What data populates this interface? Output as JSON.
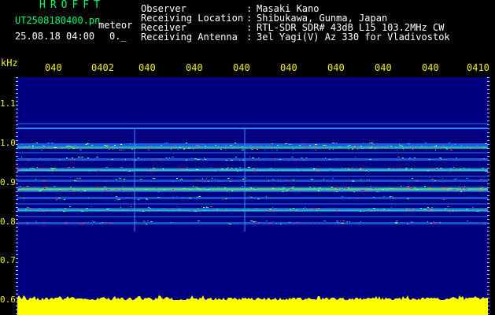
{
  "header": {
    "brand": "HROFFT",
    "filename": "UT2508180400.pn",
    "meteor_label": "meteor",
    "datetime": "25.08.18 04:00",
    "unknown_value": "0._"
  },
  "info": {
    "rows": [
      {
        "label": "Observer",
        "value": "Masaki Kano"
      },
      {
        "label": "Receiving Location",
        "value": "Shibukawa, Gunma, Japan"
      },
      {
        "label": "Receiver",
        "value": "RTL-SDR SDR# 43dB L15 103.2MHz CW"
      },
      {
        "label": "Receiving Antenna",
        "value": "3el Yagi(V) Az 330 for Vladivostok"
      }
    ]
  },
  "axis": {
    "y_unit": "kHz",
    "y_ticks": [
      "1.1",
      "1.0",
      "0.9",
      "0.8",
      "0.7",
      "0.6"
    ],
    "x_ticks": [
      "040",
      "0402",
      "040",
      "040",
      "040",
      "040",
      "040",
      "040",
      "040",
      "0410"
    ]
  },
  "colors": {
    "background": "#000000",
    "plot_background": "#000080",
    "header_green": "#00ff66",
    "header_white": "#ffffff",
    "tick_yellow": "#f2ee2e",
    "bar_yellow": "#ffff00"
  }
}
